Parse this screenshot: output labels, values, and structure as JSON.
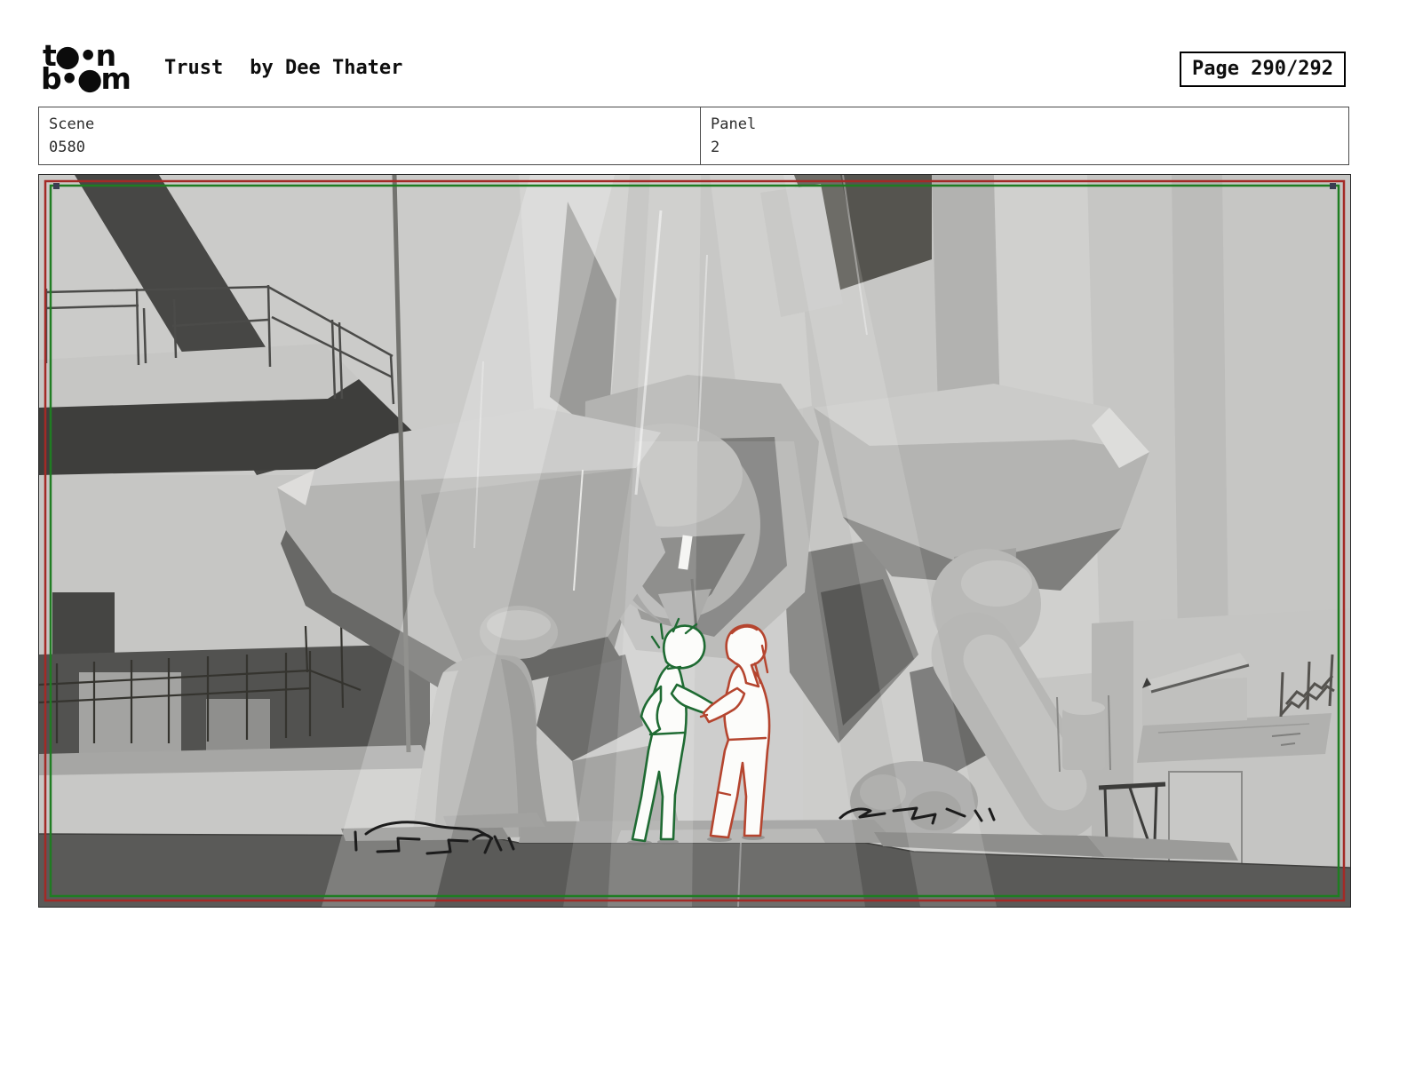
{
  "header": {
    "logo": {
      "brand": "toon boom",
      "line1": "t●•n",
      "line2": "b•●m"
    },
    "title": "Trust",
    "author": "by Dee Thater",
    "page_label": "Page 290/292"
  },
  "info_table": {
    "scene_label": "Scene",
    "scene_value": "0580",
    "panel_label": "Panel",
    "panel_value": "2"
  },
  "panel": {
    "alt": "Grayscale 3D previs: a giant crouching mech fills a hangar; a green-sketched figure and a red-sketched figure shake hands beneath its head",
    "colors": {
      "camera_frame": "#a32a26",
      "safe_frame": "#1f7d22",
      "figure_green": "#1f6b33",
      "figure_red": "#b5452f",
      "sketch_black": "#1c1c1c",
      "ground": "#5a5a58",
      "scene_base": "#c8c8c6"
    }
  }
}
